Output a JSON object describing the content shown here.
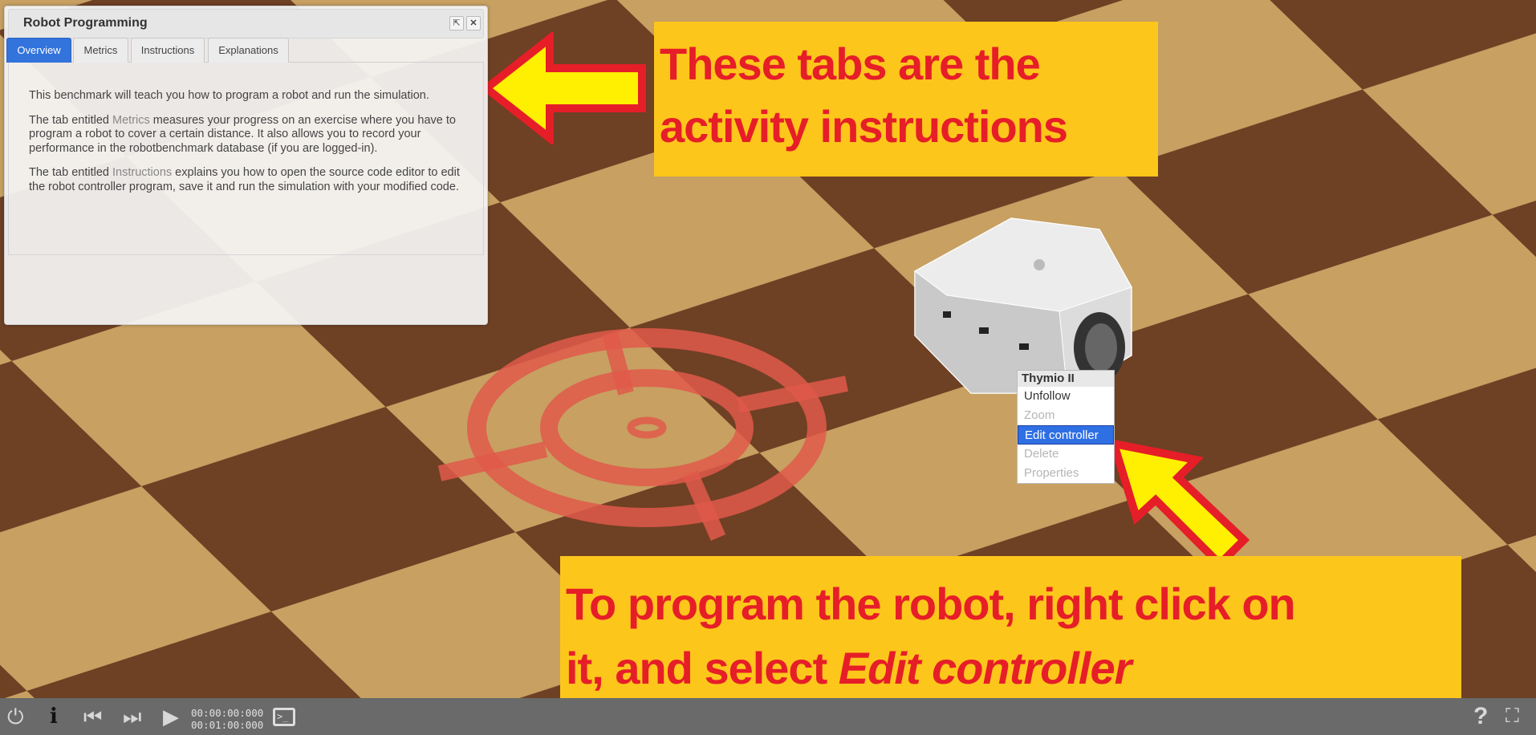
{
  "panel": {
    "title": "Robot Programming",
    "tabs": [
      {
        "label": "Overview",
        "active": true
      },
      {
        "label": "Metrics",
        "active": false
      },
      {
        "label": "Instructions",
        "active": false
      },
      {
        "label": "Explanations",
        "active": false
      }
    ],
    "overview": {
      "p1": "This benchmark will teach you how to program a robot and run the simulation.",
      "p2_before": "The tab entitled ",
      "p2_link": "Metrics",
      "p2_after": " measures your progress on an exercise where you have to program a robot to cover a certain distance. It also allows you to record your performance in the robotbenchmark database (if you are logged-in).",
      "p3_before": "The tab entitled ",
      "p3_link": "Instructions",
      "p3_after": " explains you how to open the source code editor to edit the robot controller program, save it and run the simulation with your modified code."
    }
  },
  "annotations": {
    "top_line1": "These tabs are the",
    "top_line2": "activity instructions",
    "bottom_line1": "To program the robot, right click on",
    "bottom_line2_before": "it, and select ",
    "bottom_line2_em": "Edit controller",
    "color_bg": "#fdc61b",
    "color_text": "#e61e28"
  },
  "context_menu": {
    "title": "Thymio II",
    "items": [
      {
        "label": "Unfollow",
        "enabled": true
      },
      {
        "label": "Zoom",
        "enabled": false
      },
      {
        "label": "Edit controller",
        "enabled": true,
        "selected": true
      },
      {
        "label": "Delete",
        "enabled": false
      },
      {
        "label": "Properties",
        "enabled": false
      }
    ]
  },
  "toolbar": {
    "current_time": "00:00:00:000",
    "max_time": "00:01:00:000",
    "icons": [
      "power-icon",
      "info-icon",
      "reset-icon",
      "step-icon",
      "play-icon",
      "console-icon",
      "help-icon",
      "fullscreen-icon"
    ]
  }
}
